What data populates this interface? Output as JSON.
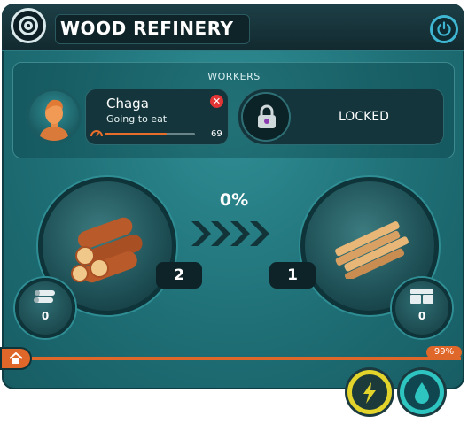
{
  "header": {
    "title": "WOOD REFINERY"
  },
  "workers": {
    "label": "WORKERS",
    "slot1": {
      "name": "Chaga",
      "status": "Going to eat",
      "hunger_value": "69",
      "hunger_fraction": 0.69
    },
    "slot2": {
      "label": "LOCKED"
    }
  },
  "production": {
    "progress_text": "0%",
    "input_count": "2",
    "output_count": "1",
    "input_stock": "0",
    "output_stock": "0"
  },
  "footer": {
    "percent_label": "99%",
    "progress_fraction": 0.99
  },
  "colors": {
    "accent_orange": "#e0672a",
    "panel_teal": "#1f6f76",
    "power_yellow": "#e3d42b",
    "water_cyan": "#2ec4c0"
  },
  "icons": {
    "logo": "refinery-logo-icon",
    "power": "power-icon",
    "remove": "close-icon",
    "lock": "lock-icon",
    "input": "logs-icon",
    "output": "planks-icon",
    "home": "home-icon",
    "energy": "lightning-icon",
    "water": "water-drop-icon"
  }
}
